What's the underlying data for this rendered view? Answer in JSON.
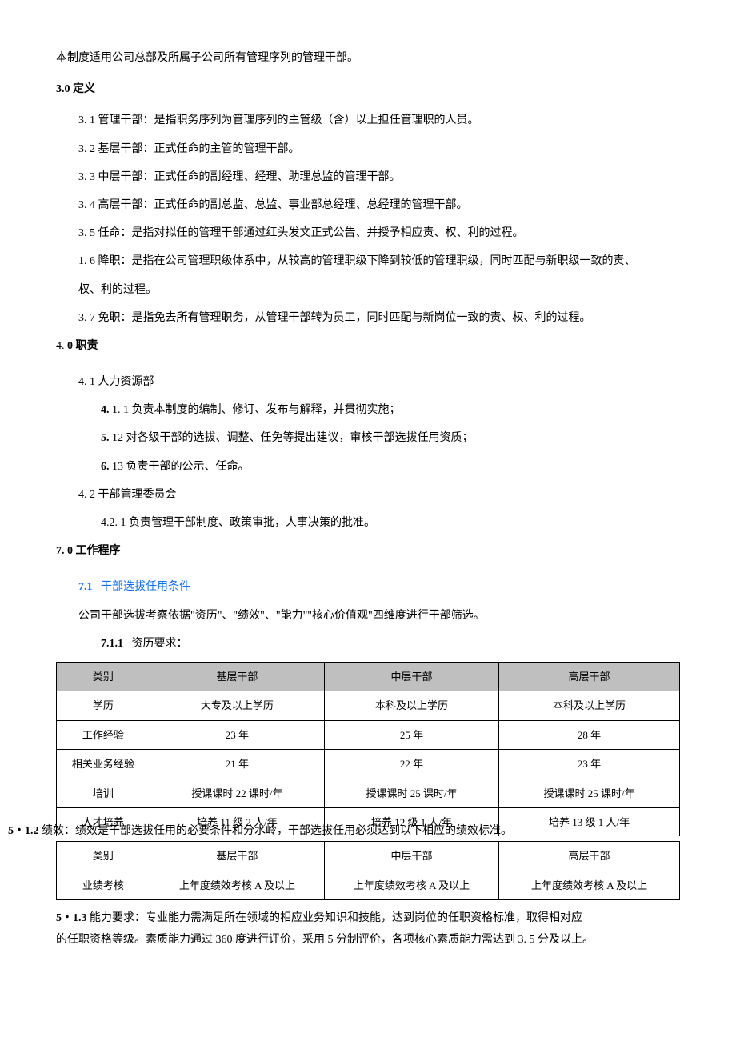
{
  "intro": "本制度适用公司总部及所属子公司所有管理序列的管理干部。",
  "s3": {
    "title": "3.0 定义",
    "i1": "3. 1 管理干部：是指职务序列为管理序列的主管级（含）以上担任管理职的人员。",
    "i2": "3. 2 基层干部：正式任命的主管的管理干部。",
    "i3": "3. 3 中层干部：正式任命的副经理、经理、助理总监的管理干部。",
    "i4": "3. 4 高层干部：正式任命的副总监、总监、事业部总经理、总经理的管理干部。",
    "i5": "3. 5 任命：是指对拟任的管理干部通过红头发文正式公告、并授予相应责、权、利的过程。",
    "i6a": "1.  6 降职：是指在公司管理职级体系中，从较高的管理职级下降到较低的管理职级，同时匹配与新职级一致的责、",
    "i6b": "权、利的过程。",
    "i7": "3.  7 免职：是指免去所有管理职务，从管理干部转为员工，同时匹配与新岗位一致的责、权、利的过程。"
  },
  "s4": {
    "title_prefix": "4.",
    "title_rest": "0 职责",
    "i41": "4. 1   人力资源部",
    "i411_prefix": "4.",
    "i411_rest": "1. 1 负责本制度的编制、修订、发布与解释，并贯彻实施；",
    "i412_prefix": "5.",
    "i412_rest": "12 对各级干部的选拔、调整、任免等提出建议，审核干部选拔任用资质；",
    "i413_prefix": "6.",
    "i413_rest": "13 负责干部的公示、任命。",
    "i42": "4. 2 干部管理委员会",
    "i421": "4.2.  1 负责管理干部制度、政策审批，人事决策的批准。"
  },
  "s7": {
    "title_prefix": "7.",
    "title_rest": "0 工作程序",
    "i71_prefix": "7.1",
    "i71_rest": "干部选拔任用条件",
    "i71_desc": "公司干部选拔考察依据\"资历\"、\"绩效\"、\"能力\"\"核心价值观\"四维度进行干部筛选。",
    "i711_prefix": "7.1.1",
    "i711_rest": "资历要求："
  },
  "table1": {
    "headers": [
      "类别",
      "基层干部",
      "中层干部",
      "高层干部"
    ],
    "rows": [
      [
        "学历",
        "大专及以上学历",
        "本科及以上学历",
        "本科及以上学历"
      ],
      [
        "工作经验",
        "23 年",
        "25 年",
        "28 年"
      ],
      [
        "相关业务经验",
        "21 年",
        "22 年",
        "23 年"
      ],
      [
        "培训",
        "授课课时 22 课时/年",
        "授课课时 25 课时/年",
        "授课课时 25 课时/年"
      ],
      [
        "人才培养",
        "培养 11 级 2 人/年",
        "培养 12 级 1 人/年",
        "培养 13 级 1 人/年"
      ]
    ]
  },
  "s512": {
    "prefix": "5・1.2",
    "rest": "绩效：绩效是干部选拔任用的必要条件和分水岭，干部选拔任用必须达到以下相应的绩效标准。"
  },
  "table2": {
    "headers": [
      "类别",
      "基层干部",
      "中层干部",
      "高层干部"
    ],
    "rows": [
      [
        "业绩考核",
        "上年度绩效考核 A 及以上",
        "上年度绩效考核 A 及以上",
        "上年度绩效考核 A 及以上"
      ]
    ]
  },
  "s513": {
    "prefix": "5・1.3",
    "line1": "能力要求：专业能力需满足所在领域的相应业务知识和技能，达到岗位的任职资格标准，取得相对应",
    "line2": "的任职资格等级。素质能力通过 360 度进行评价，采用 5 分制评价，各项核心素质能力需达到 3. 5 分及以上。"
  }
}
